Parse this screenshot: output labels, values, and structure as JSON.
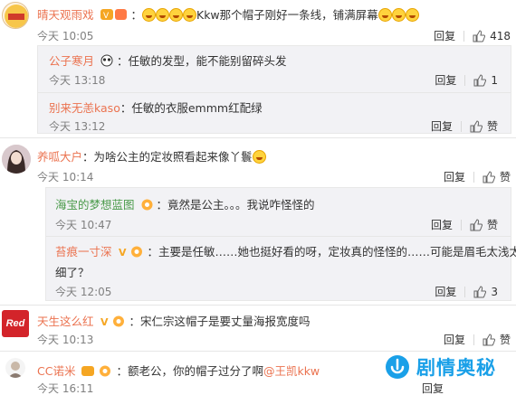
{
  "comments": [
    {
      "user": "晴天观雨戏",
      "text_prefix": "：",
      "text": "Kkw那个帽子刚好一条线，铺满屏幕",
      "time": "今天 10:05",
      "reply": "回复",
      "likes": "418",
      "subcomments": [
        {
          "user": "公子寒月",
          "text": "：任敏的发型，能不能别留碎头发",
          "time": "今天 13:18",
          "reply": "回复",
          "likes": "1"
        },
        {
          "user": "别来无恙kaso",
          "text": "：任敏的衣服emmm红配绿",
          "time": "今天 13:12",
          "reply": "回复",
          "likes": "赞"
        }
      ]
    },
    {
      "user": "养呱大户",
      "text": "：为啥公主的定妆照看起来像丫鬟",
      "time": "今天 10:14",
      "reply": "回复",
      "likes": "赞",
      "subcomments": [
        {
          "user": "海宝的梦想蓝图",
          "text": "：竟然是公主。。。我说咋怪怪的",
          "time": "今天 10:47",
          "reply": "回复",
          "likes": "赞"
        },
        {
          "user": "苔痕一寸深",
          "text_line1": "：主要是任敏……她也挺好看的呀，定妆真的怪怪的……可能是眉毛太浅太",
          "text_line2": "细了？",
          "time": "今天 12:05",
          "reply": "回复",
          "likes": "3"
        }
      ]
    },
    {
      "user": "天生这么红",
      "text": "：宋仁宗这帽子是要丈量海报宽度吗",
      "time": "今天 10:13",
      "reply": "回复",
      "likes": "赞",
      "avatar_text": "Red"
    },
    {
      "user": "CC诺米",
      "text": "：额老公，你的帽子过分了啊",
      "mention": "@王凯kkw",
      "time": "今天 16:11",
      "reply": "回复"
    }
  ],
  "watermark": "剧情奥秘",
  "colors": {
    "username": "#eb7350",
    "sub_bg": "#f2f2f5",
    "watermark": "#1aa0e8"
  }
}
